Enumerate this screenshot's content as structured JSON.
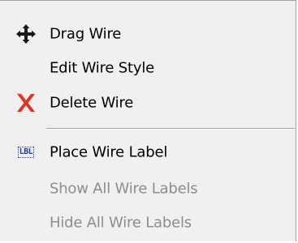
{
  "menu": {
    "items": [
      {
        "label": "Drag Wire",
        "icon": "move-arrows-icon",
        "enabled": true
      },
      {
        "label": "Edit Wire Style",
        "icon": "",
        "enabled": true
      },
      {
        "label": "Delete Wire",
        "icon": "red-x-icon",
        "enabled": true
      },
      {
        "label": "Place Wire Label",
        "icon": "lbl-icon",
        "icon_text": "LBL",
        "enabled": true
      },
      {
        "label": "Show All Wire Labels",
        "icon": "",
        "enabled": false
      },
      {
        "label": "Hide All Wire Labels",
        "icon": "",
        "enabled": false
      }
    ]
  },
  "colors": {
    "menu_background": "#f0f0f0",
    "disabled_text": "#8d8d8d",
    "delete_icon": "#e0321e",
    "label_icon": "#1b3ea8"
  }
}
